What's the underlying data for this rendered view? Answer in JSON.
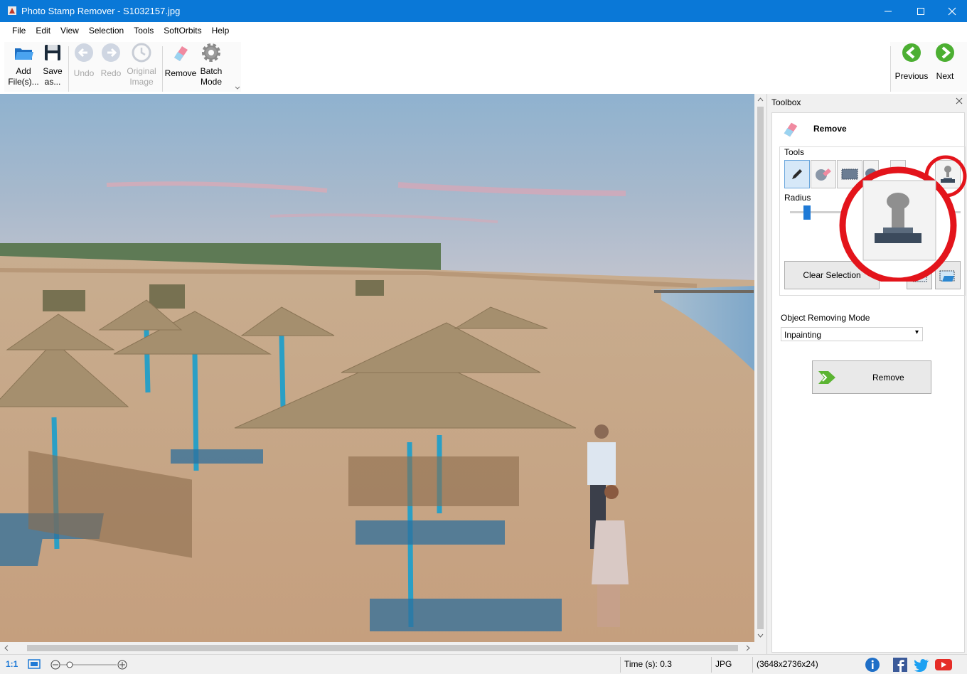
{
  "window": {
    "title": "Photo Stamp Remover - S1032157.jpg"
  },
  "menu": [
    "File",
    "Edit",
    "View",
    "Selection",
    "Tools",
    "SoftOrbits",
    "Help"
  ],
  "toolbar": {
    "add_files": "Add File(s)...",
    "save_as": "Save as...",
    "undo": "Undo",
    "redo": "Redo",
    "original_image": "Original Image",
    "remove": "Remove",
    "batch_mode": "Batch Mode",
    "previous": "Previous",
    "next": "Next"
  },
  "toolbox": {
    "title": "Toolbox",
    "section_title": "Remove",
    "tools_label": "Tools",
    "radius_label": "Radius",
    "radius_value": 0.1,
    "clear_selection": "Clear Selection",
    "mode_label": "Object Removing Mode",
    "mode_value": "Inpainting",
    "remove_button": "Remove"
  },
  "status": {
    "zoom_actual": "1:1",
    "time": "Time (s): 0.3",
    "format": "JPG",
    "dimensions": "(3648x2736x24)"
  },
  "colors": {
    "title_bar": "#0a78d7",
    "highlight_ring": "#e3141b",
    "nav_green": "#4caf32"
  }
}
